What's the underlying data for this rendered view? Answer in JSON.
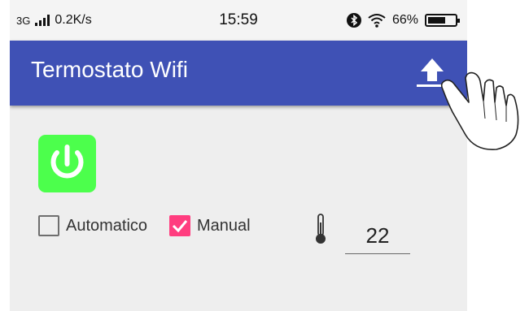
{
  "status_bar": {
    "network_type": "3G",
    "data_speed": "0.2K/s",
    "time": "15:59",
    "battery_percent": "66%",
    "battery_level": 0.66,
    "icons": [
      "signal-bars-icon",
      "bluetooth-icon",
      "wifi-icon",
      "battery-icon"
    ]
  },
  "app_bar": {
    "title": "Termostato Wifi",
    "upload_icon": "upload-icon",
    "color": "#3f51b5"
  },
  "controls": {
    "power_icon": "power-icon",
    "power_color": "#4cff4c",
    "automatico": {
      "label": "Automatico",
      "checked": false
    },
    "manual": {
      "label": "Manual",
      "checked": true,
      "color": "#ff3d7f"
    },
    "thermometer_icon": "thermometer-icon",
    "temperature": "22"
  },
  "overlay": {
    "icon": "hand-pointer-icon"
  }
}
